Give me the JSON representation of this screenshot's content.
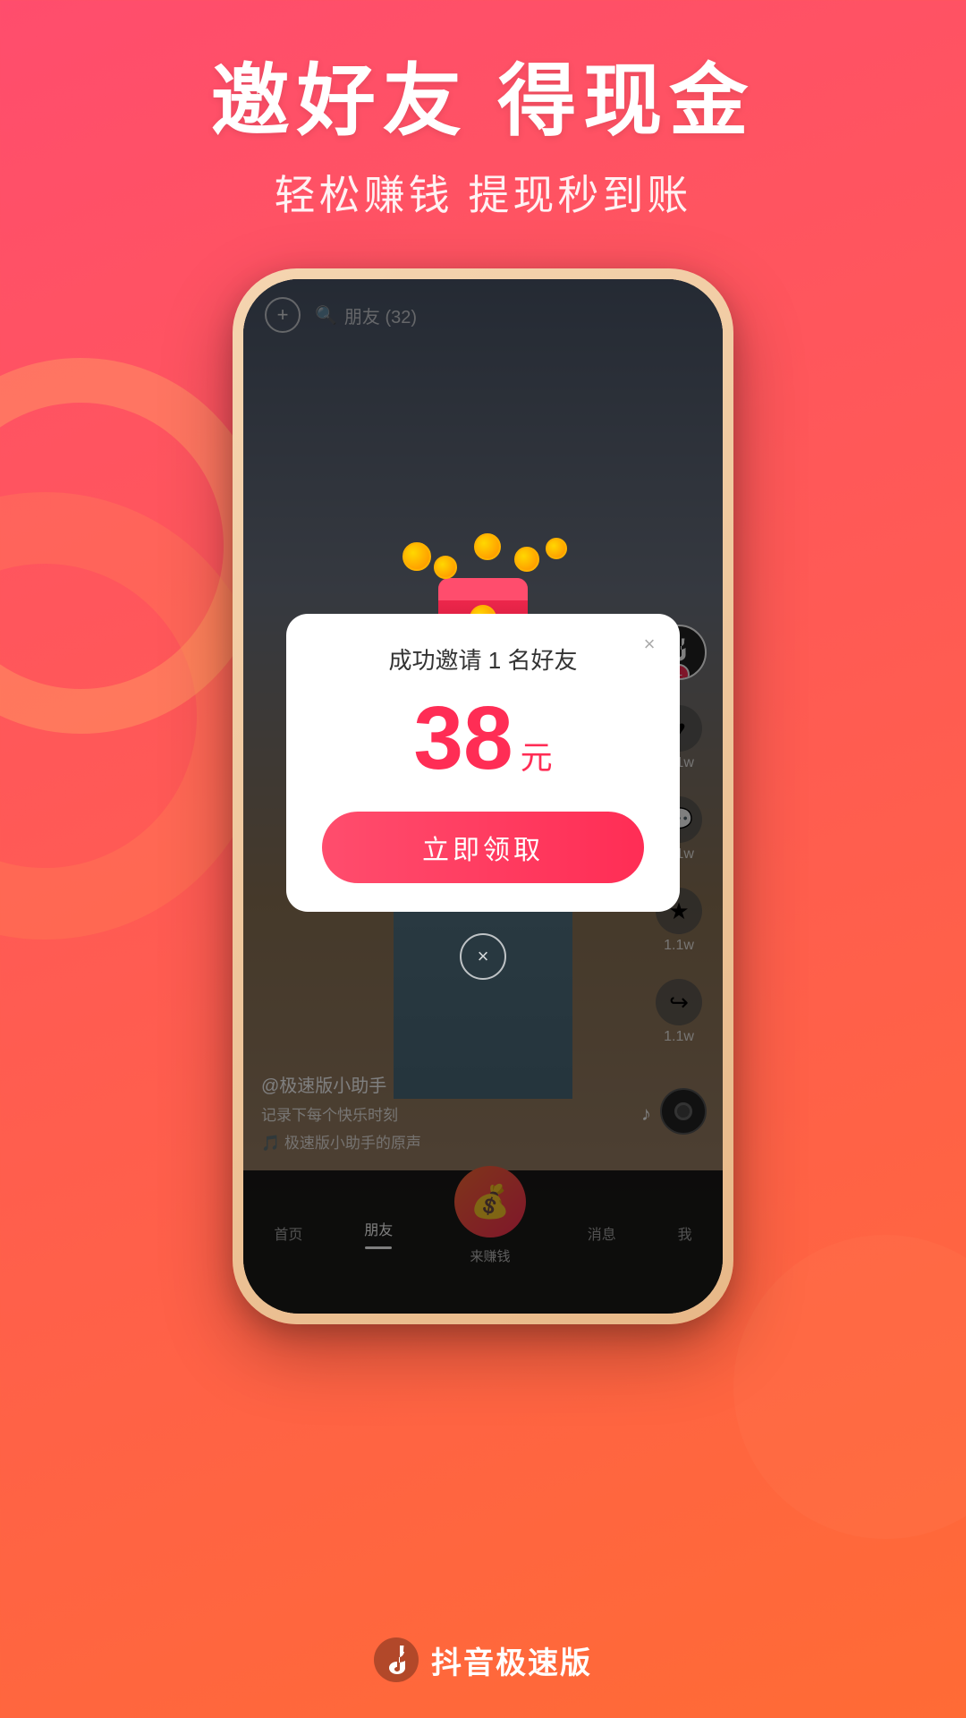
{
  "background": {
    "gradient_start": "#ff4d6d",
    "gradient_end": "#ff6b35"
  },
  "header": {
    "main_title": "邀好友 得现金",
    "sub_title": "轻松赚钱 提现秒到账"
  },
  "phone": {
    "top_bar": {
      "add_btn": "+",
      "search_icon": "🔍",
      "search_text": "朋友 (32)"
    },
    "modal": {
      "title": "成功邀请 1 名好友",
      "amount": "38",
      "unit": "元",
      "claim_btn": "立即领取",
      "close_btn": "×"
    },
    "video_overlay": {
      "username": "@极速版小助手",
      "description": "记录下每个快乐时刻",
      "sound": "🎵 极速版小助手的原声"
    },
    "right_sidebar": {
      "avatar_plus": "+",
      "like_count": "1.1w",
      "comment_count": "1.1w",
      "favorite_count": "1.1w",
      "share_count": "1.1w"
    },
    "bottom_nav": {
      "items": [
        {
          "label": "首页",
          "active": false
        },
        {
          "label": "朋友",
          "active": true
        },
        {
          "label": "来赚钱",
          "active": false,
          "center": true
        },
        {
          "label": "消息",
          "active": false
        },
        {
          "label": "我",
          "active": false
        }
      ]
    },
    "dismiss_btn": "×"
  },
  "branding": {
    "app_name": "抖音极速版"
  }
}
